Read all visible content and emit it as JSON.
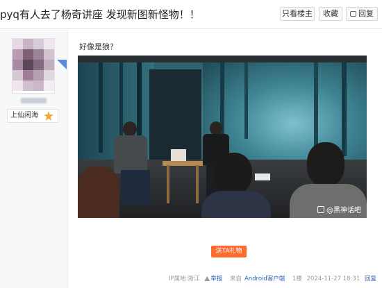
{
  "header": {
    "title": "pyq有人去了杨奇讲座 发现新图新怪物！！",
    "only_op_label": "只看楼主",
    "collect_label": "收藏",
    "reply_label": "回复"
  },
  "author": {
    "level_name": "上仙闲海"
  },
  "post": {
    "text": "好像是狼？",
    "image_watermark": "@黑神话吧",
    "gift_button": "送TA礼物"
  },
  "footer": {
    "ip_location": "IP属地:浙江",
    "report_label": "举报",
    "source_prefix": "来自",
    "source_client": "Android客户端",
    "floor": "1楼",
    "timestamp": "2024-11-27 18:31",
    "reply_label": "回复"
  },
  "colors": {
    "gift_button": "#ff6a2f",
    "link": "#2d64b3",
    "sidebar_bg": "#f7f8fa"
  },
  "icons": {
    "reply": "reply-icon",
    "level": "level-star-icon",
    "report": "report-icon"
  }
}
